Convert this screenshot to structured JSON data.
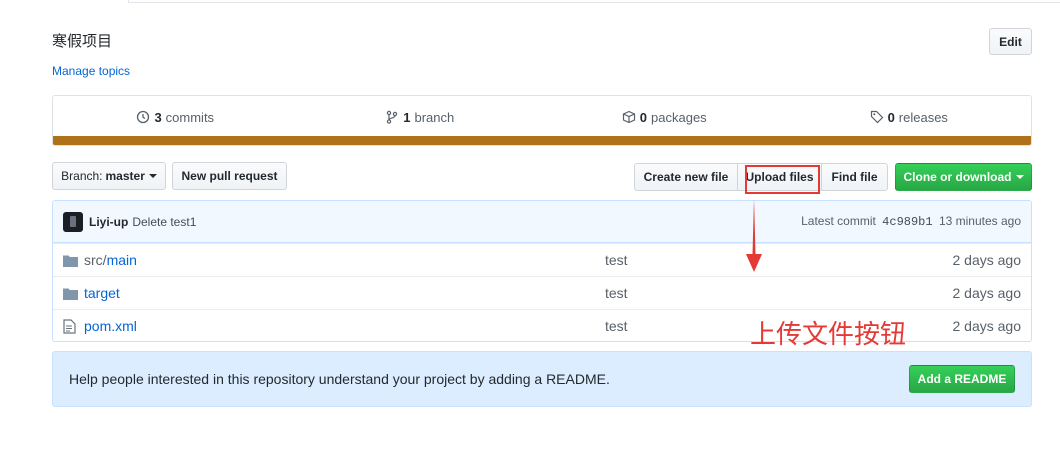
{
  "repo": {
    "description": "寒假项目",
    "manage_topics": "Manage topics",
    "edit_label": "Edit"
  },
  "summary": {
    "commits_count": "3",
    "commits_label": "commits",
    "branch_count": "1",
    "branch_label": "branch",
    "packages_count": "0",
    "packages_label": "packages",
    "releases_count": "0",
    "releases_label": "releases",
    "language_color": "#b07219"
  },
  "toolbar": {
    "branch_prefix": "Branch:",
    "branch_name": "master",
    "new_pull_request": "New pull request",
    "create_new_file": "Create new file",
    "upload_files": "Upload files",
    "find_file": "Find file",
    "clone_or_download": "Clone or download"
  },
  "latest_commit": {
    "author": "Liyi-up",
    "message": "Delete test1",
    "prefix": "Latest commit",
    "sha": "4c989b1",
    "age": "13 minutes ago"
  },
  "files": [
    {
      "type": "folder",
      "name_main": "src/",
      "name_sub": "main",
      "message": "test",
      "age": "2 days ago"
    },
    {
      "type": "folder",
      "name_main": "target",
      "name_sub": "",
      "message": "test",
      "age": "2 days ago"
    },
    {
      "type": "file",
      "name_main": "pom.xml",
      "name_sub": "",
      "message": "test",
      "age": "2 days ago"
    }
  ],
  "readme_banner": {
    "text": "Help people interested in this repository understand your project by adding a README.",
    "button": "Add a README"
  },
  "annotation": {
    "text": "上传文件按钮",
    "color": "#e53935"
  }
}
